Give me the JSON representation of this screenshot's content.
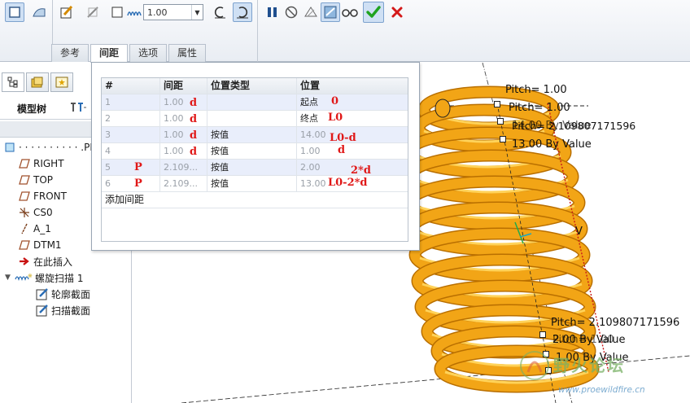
{
  "ribbon": {
    "pitch_value": "1.00",
    "tabs": [
      {
        "label": "参考",
        "active": false
      },
      {
        "label": "间距",
        "active": true
      },
      {
        "label": "选项",
        "active": false
      },
      {
        "label": "属性",
        "active": false
      }
    ]
  },
  "left_panel": {
    "tree_title": "模型树",
    "nodes": [
      {
        "label": "· · · · · · · · · · .PR",
        "icon": "part-icon"
      },
      {
        "label": "RIGHT",
        "icon": "datum-plane-icon"
      },
      {
        "label": "TOP",
        "icon": "datum-plane-icon"
      },
      {
        "label": "FRONT",
        "icon": "datum-plane-icon"
      },
      {
        "label": "CS0",
        "icon": "coordinate-system-icon"
      },
      {
        "label": "A_1",
        "icon": "datum-axis-icon"
      },
      {
        "label": "DTM1",
        "icon": "datum-plane-icon"
      },
      {
        "label": "在此插入",
        "icon": "insert-arrow-icon"
      },
      {
        "label": "螺旋扫描 1",
        "icon": "helical-sweep-icon"
      },
      {
        "label": "轮廓截面",
        "icon": "sketch-icon"
      },
      {
        "label": "扫描截面",
        "icon": "sketch-icon"
      }
    ]
  },
  "spacing_table": {
    "headers": [
      "#",
      "间距",
      "位置类型",
      "位置"
    ],
    "rows": [
      {
        "num": "1",
        "pitch": "1.00",
        "type": "",
        "position": "起点",
        "note_pitch": "d",
        "note_pos": "0"
      },
      {
        "num": "2",
        "pitch": "1.00",
        "type": "",
        "position": "终点",
        "note_pitch": "d",
        "note_pos": "L0"
      },
      {
        "num": "3",
        "pitch": "1.00",
        "type": "按值",
        "position": "14.00",
        "note_pitch": "d",
        "note_pos": "L0-d"
      },
      {
        "num": "4",
        "pitch": "1.00",
        "type": "按值",
        "position": "1.00",
        "note_pitch": "d",
        "note_pos": "d"
      },
      {
        "num": "5",
        "pitch": "2.109...",
        "type": "按值",
        "position": "2.00",
        "note_pitch": "P",
        "note_pos": "2*d"
      },
      {
        "num": "6",
        "pitch": "2.109...",
        "type": "按值",
        "position": "13.00",
        "note_pitch": "P",
        "note_pos": "L0-2*d"
      }
    ],
    "add_label": "添加间距"
  },
  "viewport_labels": {
    "pitch_top_1": "Pitch= 1.00",
    "pitch_top_2": "Pitch= 1.00",
    "pitch_top_3": "Pitch= 2.109807171596",
    "by_value_top_1": "14.00 By Value",
    "by_value_top_2": "13.00 By Value",
    "axis_letter": "V",
    "pitch_bottom_1": "Pitch= 2.109807171596",
    "by_value_bottom_1": "2.00 By Value",
    "pitch_bottom_2": "Pitch= 1.00",
    "by_value_bottom_2": "1.00 By Value"
  },
  "watermark": {
    "title": "野火论坛",
    "url": "www.proewildfire.cn"
  },
  "colors": {
    "spring": "#f2a516",
    "spring_dark": "#b96f00",
    "annotation_red": "#e01818",
    "confirm_green": "#1fa31f",
    "cancel_red": "#d41919"
  }
}
